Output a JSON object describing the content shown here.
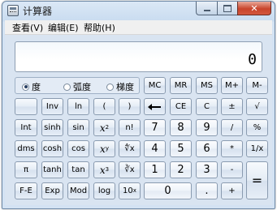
{
  "window": {
    "title": "计算器"
  },
  "menu": [
    "查看(V)",
    "编辑(E)",
    "帮助(H)"
  ],
  "display": {
    "value": "0"
  },
  "angle": [
    {
      "label": "度",
      "selected": true
    },
    {
      "label": "弧度",
      "selected": false
    },
    {
      "label": "梯度",
      "selected": false
    }
  ],
  "keys": {
    "mc": "MC",
    "mr": "MR",
    "ms": "MS",
    "mplus": "M+",
    "mminus": "M-",
    "inv": "Inv",
    "ln": "ln",
    "lparen": "(",
    "rparen": ")",
    "ce": "CE",
    "c": "C",
    "plusminus": "±",
    "sqrt": "√",
    "int": "Int",
    "sinh": "sinh",
    "sin": "sin",
    "x2": "x",
    "x2_sup": "2",
    "fact": "n!",
    "n7": "7",
    "n8": "8",
    "n9": "9",
    "div": "/",
    "pct": "%",
    "dms": "dms",
    "cosh": "cosh",
    "cos": "cos",
    "xy": "x",
    "xy_sup": "y",
    "yroot": "∜x",
    "n4": "4",
    "n5": "5",
    "n6": "6",
    "mul": "*",
    "recip": "1/x",
    "pi": "π",
    "tanh": "tanh",
    "tan": "tan",
    "x3": "x",
    "x3_sup": "3",
    "cbrt": "∛x",
    "n1": "1",
    "n2": "2",
    "n3": "3",
    "minus": "-",
    "eq": "=",
    "fe": "F-E",
    "exp": "Exp",
    "mod": "Mod",
    "log": "log",
    "ten": "10",
    "ten_sup": "x",
    "n0": "0",
    "dot": ".",
    "plus": "+"
  }
}
